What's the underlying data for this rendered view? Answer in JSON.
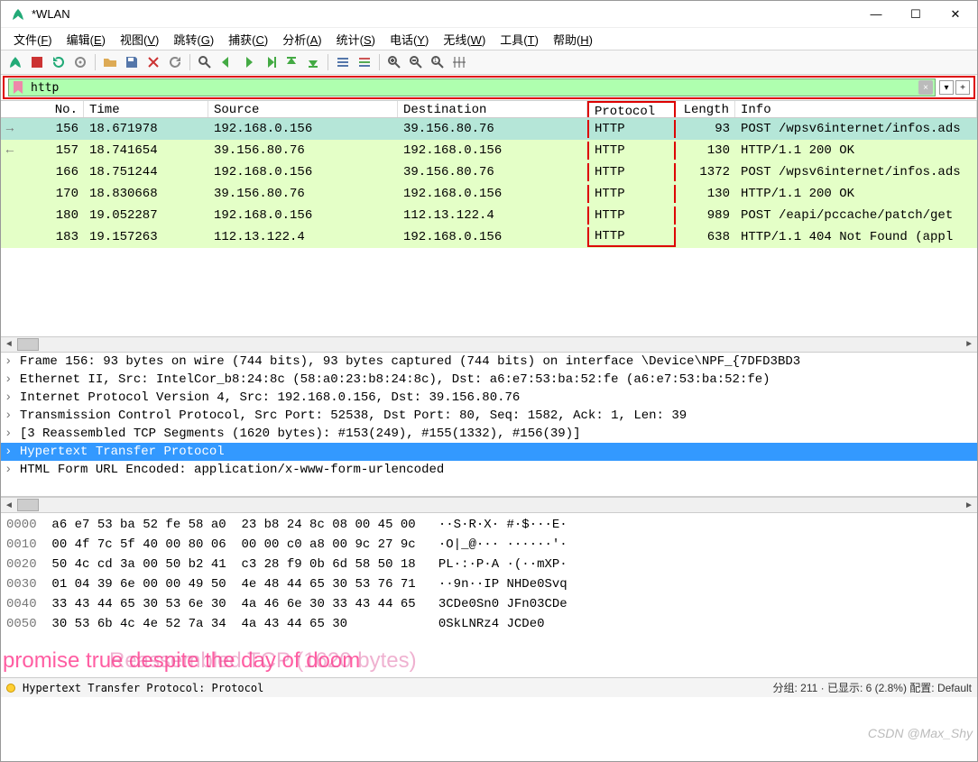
{
  "title": "*WLAN",
  "menu": [
    "文件(F)",
    "编辑(E)",
    "视图(V)",
    "跳转(G)",
    "捕获(C)",
    "分析(A)",
    "统计(S)",
    "电话(Y)",
    "无线(W)",
    "工具(T)",
    "帮助(H)"
  ],
  "filter": {
    "value": "http",
    "clear": "×",
    "plus": "+",
    "arrow": "▾"
  },
  "columns": {
    "no": "No.",
    "time": "Time",
    "source": "Source",
    "destination": "Destination",
    "protocol": "Protocol",
    "length": "Length",
    "info": "Info"
  },
  "rows": [
    {
      "no": "156",
      "time": "18.671978",
      "src": "192.168.0.156",
      "dst": "39.156.80.76",
      "proto": "HTTP",
      "len": "93",
      "info": "POST /wpsv6internet/infos.ads",
      "sel": true,
      "arrow": "→"
    },
    {
      "no": "157",
      "time": "18.741654",
      "src": "39.156.80.76",
      "dst": "192.168.0.156",
      "proto": "HTTP",
      "len": "130",
      "info": "HTTP/1.1 200 OK",
      "arrow": "←"
    },
    {
      "no": "166",
      "time": "18.751244",
      "src": "192.168.0.156",
      "dst": "39.156.80.76",
      "proto": "HTTP",
      "len": "1372",
      "info": "POST /wpsv6internet/infos.ads"
    },
    {
      "no": "170",
      "time": "18.830668",
      "src": "39.156.80.76",
      "dst": "192.168.0.156",
      "proto": "HTTP",
      "len": "130",
      "info": "HTTP/1.1 200 OK"
    },
    {
      "no": "180",
      "time": "19.052287",
      "src": "192.168.0.156",
      "dst": "112.13.122.4",
      "proto": "HTTP",
      "len": "989",
      "info": "POST /eapi/pccache/patch/get"
    },
    {
      "no": "183",
      "time": "19.157263",
      "src": "112.13.122.4",
      "dst": "192.168.0.156",
      "proto": "HTTP",
      "len": "638",
      "info": "HTTP/1.1 404 Not Found  (appl"
    }
  ],
  "details": [
    "Frame 156: 93 bytes on wire (744 bits), 93 bytes captured (744 bits) on interface \\Device\\NPF_{7DFD3BD3",
    "Ethernet II, Src: IntelCor_b8:24:8c (58:a0:23:b8:24:8c), Dst: a6:e7:53:ba:52:fe (a6:e7:53:ba:52:fe)",
    "Internet Protocol Version 4, Src: 192.168.0.156, Dst: 39.156.80.76",
    "Transmission Control Protocol, Src Port: 52538, Dst Port: 80, Seq: 1582, Ack: 1, Len: 39",
    "[3 Reassembled TCP Segments (1620 bytes): #153(249), #155(1332), #156(39)]",
    "Hypertext Transfer Protocol",
    "HTML Form URL Encoded: application/x-www-form-urlencoded"
  ],
  "details_hi": 5,
  "hex": [
    {
      "off": "0000",
      "b": "a6 e7 53 ba 52 fe 58 a0  23 b8 24 8c 08 00 45 00",
      "a": "··S·R·X· #·$···E·"
    },
    {
      "off": "0010",
      "b": "00 4f 7c 5f 40 00 80 06  00 00 c0 a8 00 9c 27 9c",
      "a": "·O|_@··· ······'·"
    },
    {
      "off": "0020",
      "b": "50 4c cd 3a 00 50 b2 41  c3 28 f9 0b 6d 58 50 18",
      "a": "PL·:·P·A ·(··mXP·"
    },
    {
      "off": "0030",
      "b": "01 04 39 6e 00 00 49 50  4e 48 44 65 30 53 76 71",
      "a": "··9n··IP NHDe0Svq"
    },
    {
      "off": "0040",
      "b": "33 43 44 65 30 53 6e 30  4a 46 6e 30 33 43 44 65",
      "a": "3CDe0Sn0 JFn03CDe"
    },
    {
      "off": "0050",
      "b": "30 53 6b 4c 4e 52 7a 34  4a 43 44 65 30",
      "a": "0SkLNRz4 JCDe0"
    }
  ],
  "watermark": {
    "line": "promise true despite the day of doom",
    "ghost": "Reassembled TCP (1620 bytes)"
  },
  "status": {
    "text": "Hypertext Transfer Protocol: Protocol",
    "right": "分组: 211  ·  已显示: 6 (2.8%)   配置: Default"
  },
  "csdn": "CSDN @Max_Shy"
}
